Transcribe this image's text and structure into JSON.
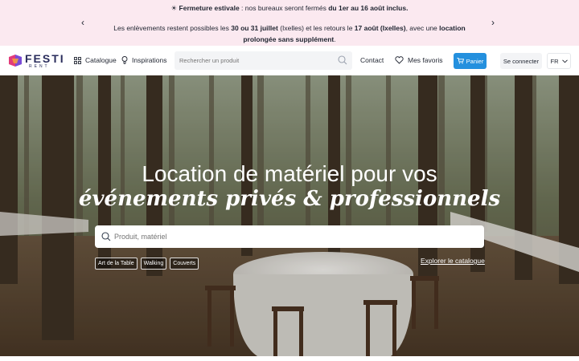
{
  "announcement": {
    "line1": {
      "icon": "sun-icon",
      "bold": "Fermeture estivale",
      "text": " : nos bureaux seront fermés ",
      "bold2": "du 1er au 16 août inclus."
    },
    "line2": {
      "p1": "Les enlèvements restent possibles les ",
      "b1": "30 ou 31 juillet",
      "p2": " (Ixelles) et les retours le ",
      "b2": "17 août (Ixelles)",
      "p3": ", avec une ",
      "b3": "location prolongée sans supplément",
      "p4": "."
    },
    "prev_arrow": "‹",
    "next_arrow": "›"
  },
  "header": {
    "logo_text": "FESTI",
    "logo_sub": "RENT",
    "nav": {
      "catalogue": "Catalogue",
      "inspirations": "Inspirations",
      "contact": "Contact",
      "favorites": "Mes favoris"
    },
    "search_placeholder": "Rechercher un produit",
    "cart_label": "Panier",
    "login_label": "Se connecter",
    "lang_label": "FR"
  },
  "hero": {
    "title_line1": "Location de matériel pour vos",
    "title_line2": "événements privés & professionnels",
    "search_placeholder": "Produit, matériel",
    "tags": [
      "Art de la Table",
      "Walking",
      "Couverts"
    ],
    "explore_label": "Explorer le catalogue"
  },
  "colors": {
    "announce_bg": "#fbe9f0",
    "cart_blue": "#2490de",
    "logo_navy": "#2a2d5c"
  }
}
